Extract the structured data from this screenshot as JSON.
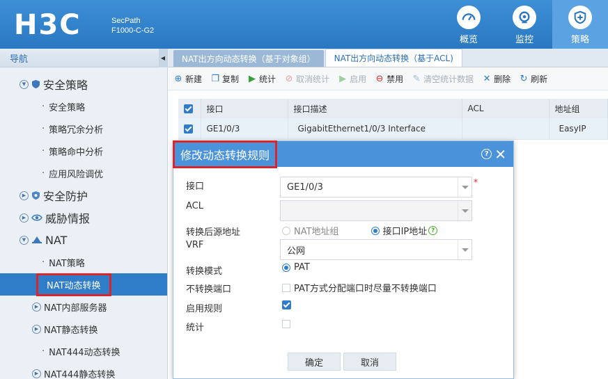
{
  "header": {
    "logo": "H3C",
    "product_line1": "SecPath",
    "product_line2": "F1000-C-G2",
    "nav": [
      {
        "label": "概览",
        "icon": "dashboard-icon"
      },
      {
        "label": "监控",
        "icon": "monitor-icon"
      },
      {
        "label": "策略",
        "icon": "shield-icon",
        "active": true
      }
    ]
  },
  "sidebar": {
    "title": "导航",
    "groups": {
      "security_policy": "安全策略",
      "security_policy_items": [
        "安全策略",
        "策略冗余分析",
        "策略命中分析",
        "应用风险调优"
      ],
      "security_protection": "安全防护",
      "threat_intel": "威胁情报",
      "nat": "NAT",
      "nat_policy": "NAT策略",
      "nat_dynamic": "NAT动态转换",
      "nat_internal_server": "NAT内部服务器",
      "nat_static": "NAT静态转换",
      "nat444_dynamic": "NAT444动态转换",
      "nat444_static": "NAT444静态转换"
    }
  },
  "tabs": [
    "NAT出方向动态转换（基于对象组）",
    "NAT出方向动态转换（基于ACL)"
  ],
  "toolbar": {
    "new": "新建",
    "copy": "复制",
    "stats": "统计",
    "cancel_stats": "取消统计",
    "enable": "启用",
    "disable": "禁用",
    "clear_stats": "清空统计数据",
    "delete": "删除",
    "refresh": "刷新"
  },
  "table": {
    "headers": [
      "接口",
      "接口描述",
      "ACL",
      "地址组"
    ],
    "row": {
      "interface": "GE1/0/3",
      "description": "GigabitEthernet1/0/3 Interface",
      "acl": "",
      "addr_group": "EasyIP"
    }
  },
  "dialog": {
    "title": "修改动态转换规则",
    "labels": {
      "interface": "接口",
      "acl": "ACL",
      "src_addr": "转换后源地址",
      "vrf": "VRF",
      "mode": "转换模式",
      "no_port": "不转换端口",
      "enable_rule": "启用规则",
      "stats": "统计"
    },
    "interface_value": "GE1/0/3",
    "required_mark": "*",
    "src_option_nat_group": "NAT地址组",
    "src_option_interface_ip": "接口IP地址",
    "vrf_value": "公网",
    "mode_value": "PAT",
    "no_port_text": "PAT方式分配端口时尽量不转换端口",
    "ok": "确定",
    "cancel": "取消"
  }
}
